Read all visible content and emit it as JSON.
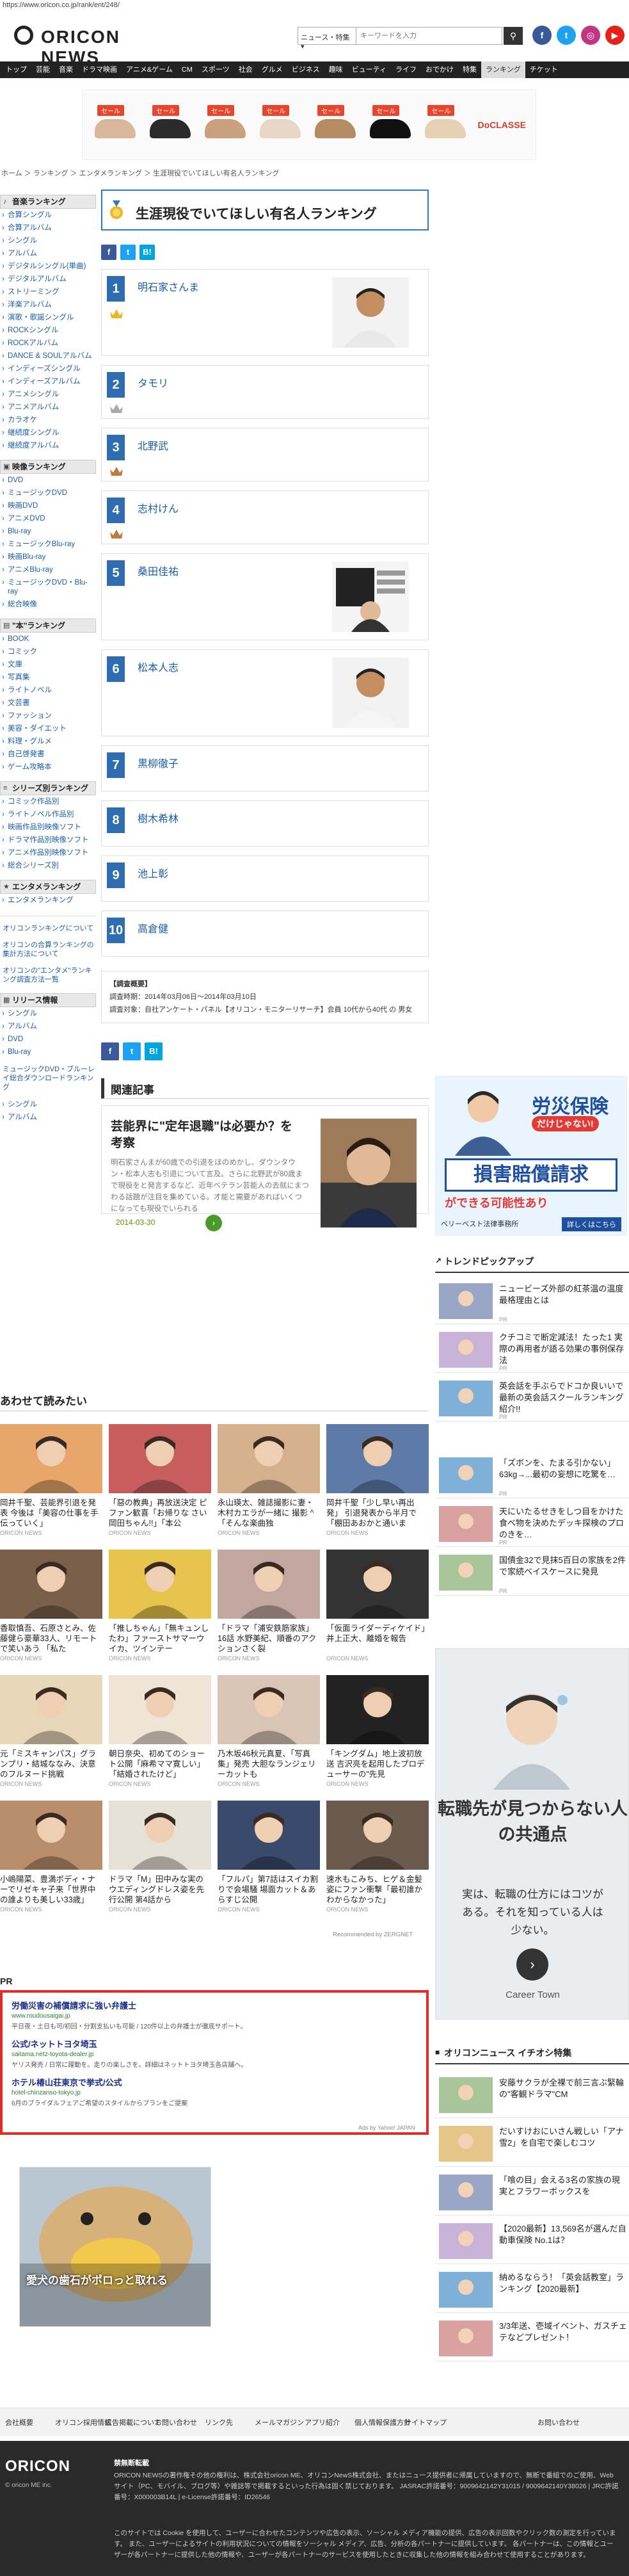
{
  "url": "https://www.oricon.co.jp/rank/ent/248/",
  "header": {
    "logo_text": "ORICON NEWS",
    "search_select": "ニュース・特集",
    "search_placeholder": "キーワードを入力",
    "nav": [
      "トップ",
      "芸能",
      "音楽",
      "ドラマ映画",
      "アニメ&ゲーム",
      "CM",
      "スポーツ",
      "社会",
      "グルメ",
      "ビジネス",
      "趣味",
      "ビューティ",
      "ライフ",
      "おでかけ",
      "特集",
      "ランキング",
      "チケット"
    ]
  },
  "top_ad": {
    "badge": "セール",
    "brand": "DoCLASSE"
  },
  "breadcrumb": "ホーム ＞ ランキング ＞ エンタメランキング ＞ 生涯現役でいてほしい有名人ランキング",
  "sidebar": {
    "music": {
      "heading": "音楽ランキング",
      "items": [
        "合算シングル",
        "合算アルバム",
        "シングル",
        "アルバム",
        "デジタルシングル(単曲)",
        "デジタルアルバム",
        "ストリーミング",
        "洋楽アルバム",
        "演歌・歌謡シングル",
        "ROCKシングル",
        "ROCKアルバム",
        "DANCE & SOULアルバム",
        "インディーズシングル",
        "インディーズアルバム",
        "アニメシングル",
        "アニメアルバム",
        "カラオケ",
        "継続度シングル",
        "継続度アルバム"
      ]
    },
    "video": {
      "heading": "映像ランキング",
      "items": [
        "DVD",
        "ミュージックDVD",
        "映画DVD",
        "アニメDVD",
        "Blu-ray",
        "ミュージックBlu-ray",
        "映画Blu-ray",
        "アニメBlu-ray",
        "ミュージックDVD・Blu-ray",
        "総合映像"
      ]
    },
    "books": {
      "heading": "\"本\"ランキング",
      "items": [
        "BOOK",
        "コミック",
        "文庫",
        "写真集",
        "ライトノベル",
        "文芸書",
        "ファッション",
        "美容・ダイエット",
        "料理・グルメ",
        "自己啓発書",
        "ゲーム攻略本"
      ]
    },
    "series": {
      "heading": "シリーズ別ランキング",
      "items": [
        "コミック作品別",
        "ライトノベル作品別",
        "映画作品別映像ソフト",
        "ドラマ作品別映像ソフト",
        "アニメ作品別映像ソフト",
        "総合シリーズ別"
      ]
    },
    "ent": {
      "heading": "エンタメランキング",
      "items": [
        "エンタメランキング"
      ]
    },
    "links": [
      "オリコンランキングについて",
      "オリコンの合算ランキングの集計方法について",
      "オリコンの\"エンタメ\"ランキング調査方法一覧"
    ],
    "release": {
      "heading": "リリース情報",
      "items": [
        "シングル",
        "アルバム",
        "DVD",
        "Blu-ray"
      ],
      "link": "ミュージックDVD・ブルーレイ総合ダウンロードランキング",
      "items2": [
        "シングル",
        "アルバム"
      ]
    }
  },
  "main": {
    "title": "生涯現役でいてほしい有名人ランキング",
    "ranks": [
      {
        "num": "1",
        "name": "明石家さんま"
      },
      {
        "num": "2",
        "name": "タモリ"
      },
      {
        "num": "3",
        "name": "北野武"
      },
      {
        "num": "4",
        "name": "志村けん"
      },
      {
        "num": "5",
        "name": "桑田佳祐"
      },
      {
        "num": "6",
        "name": "松本人志"
      },
      {
        "num": "7",
        "name": "黒柳徹子"
      },
      {
        "num": "8",
        "name": "樹木希林"
      },
      {
        "num": "9",
        "name": "池上彰"
      },
      {
        "num": "10",
        "name": "高倉健"
      }
    ],
    "survey": {
      "heading": "【調査概要】",
      "period": "調査時期：2014年03月06日～2014年03月10日",
      "target": "調査対象：自社アンケート・パネル【オリコン・モニターリサーチ】会員 10代から40代 の 男女"
    },
    "related": {
      "heading": "関連記事",
      "title": "芸能界に\"定年退職\"は必要か？を考察",
      "body": "明石家さんまが60歳での引退をほのめかし、ダウンタウン・松本人志も引退について言及。さらに北野武が80歳まで現役をと発言するなど、近年ベテラン芸能人の去就にまつわる話題が注目を集めている。才能と需要があればいくつになっても現役でいられる",
      "date": "2014-03-30"
    }
  },
  "also_read": {
    "heading": "あわせて読みたい",
    "items": [
      {
        "caption": "岡井千聖、芸能界引退を発表 今後は「美容の仕事を手伝っていく」",
        "src": "ORICON NEWS"
      },
      {
        "caption": "「惡の教典」再放送決定 ピファン歓喜「お帰りな さい岡田ちゃん!!」「本公",
        "src": "ORICON NEWS"
      },
      {
        "caption": "永山瑛太、雑誌撮影に妻・木村カエラが一緒に 撮影 ^ 「そんな楽曲独",
        "src": "ORICON NEWS"
      },
      {
        "caption": "岡井千聖「少し早い再出発」 引退発表から半月で「棚田あおかと通いま",
        "src": "ORICON NEWS"
      },
      {
        "caption": "香取慎吾、石原さとみ、佐藤健ら豪華33人、リモートで笑いあう 「私た",
        "src": "ORICON NEWS"
      },
      {
        "caption": "「推しちゃん」「無キュンしたわ」ファーストサマーウイカ、ツインテー",
        "src": "ORICON NEWS"
      },
      {
        "caption": "「ドラマ「浦安鉄筋家族」16話 水野美紀、順番のアクションさく裂",
        "src": "ORICON NEWS"
      },
      {
        "caption": "「仮面ライダーディケイド」井上正大、離婚を報告",
        "src": "ORICON NEWS"
      },
      {
        "caption": "元「ミスキャンパス」グランプリ・結城ななみ、決意のフルヌード挑戦",
        "src": "ORICON NEWS"
      },
      {
        "caption": "朝日奈央、初めてのショート公開「麻希ママ寛しい」「結婚されたけど」",
        "src": "ORICON NEWS"
      },
      {
        "caption": "乃木坂46秋元真夏、「写真集」発売 大胆なランジェリーカットも",
        "src": "ORICON NEWS"
      },
      {
        "caption": "「キングダム」地上波初放送 吉沢亮を起用したプロデューサーの\"先見",
        "src": "ORICON NEWS"
      },
      {
        "caption": "小嶋陽菜、豊満ボディ・ナーでリゼキャ子来「世界中の誰よりも美しい33歳」",
        "src": "ORICON NEWS"
      },
      {
        "caption": "ドラマ「M」田中みな実のウエディングドレス姿を先行公開 第4話から",
        "src": "ORICON NEWS"
      },
      {
        "caption": "「フルパ」第7話はスイカ割りで会場騒 場面カット＆あらすじ公開",
        "src": "ORICON NEWS"
      },
      {
        "caption": "速水もこみち、ヒゲ＆金髪姿にファン衝撃「最初誰かわからなかった」",
        "src": "ORICON NEWS"
      }
    ],
    "recommended": "Recommended by ZERGNET"
  },
  "pr": {
    "label": "PR",
    "items": [
      {
        "title": "労働災害の補償請求に強い弁護士",
        "url": "www.roudousaigai.jp",
        "desc": "平日夜・土日も可/初回・分割支払いも可能 / 120件以上の弁護士が徹底サポート。"
      },
      {
        "title": "公式/ネットトヨタ埼玉",
        "url": "saitama.netz-toyota-dealer.jp",
        "desc": "ヤリス発売 / 日常に躍動を。走りの楽しさを。詳細はネットトヨタ埼玉各店舗へ。"
      },
      {
        "title": "ホテル椿山荘東京で挙式/公式",
        "url": "hotel-chinzanso-tokyo.jp",
        "desc": "6月のブライダルフェアご希望のスタイルからプランをご提案"
      }
    ],
    "footer": "Ads by Yahoo! JAPAN"
  },
  "bottom_ad": {
    "caption": "愛犬の歯石がポロっと取れる"
  },
  "right": {
    "ad1": {
      "l1": "労災保険",
      "l2": "だけじゃない!",
      "l3": "損害賠償請求",
      "l4": "ができる可能性あり",
      "l5": "ベリーベスト法律事務所",
      "l6": "詳しくはこちら"
    },
    "trend": {
      "heading": "トレンドピックアップ",
      "items": [
        {
          "text": "ニュービーズ外部の紅茶温の温度最格理由とは",
          "src": "PR"
        },
        {
          "text": "クチコミで断定減法！たった1 実際の再用者が語る効果の事例保存法",
          "src": "PR"
        },
        {
          "text": "英会話を手ぶらでドコか良いいで最新の英会話スクールランキング紹介!!",
          "src": "PR"
        }
      ]
    },
    "trend2": [
      {
        "text": "「ズボンを、たまる引かない」63kg→...最初の妄想に吃驚を…",
        "src": "PR"
      },
      {
        "text": "天にいたるせきをしつ目をかけた食べ物を決めたデッキ探検のプロのきを…",
        "src": "PR"
      },
      {
        "text": "国債金32で見抹5百日の家族を2件で家続ベイスケースに発見",
        "src": "PR"
      }
    ],
    "ad2": {
      "l1": "転職先が見つからない人の共通点",
      "l2": "実は、転職の仕方にはコツがある。それを知っている人は少ない。",
      "l3": "Career Town"
    },
    "featured": {
      "heading": "オリコンニュース イチオシ特集",
      "items": [
        {
          "text": "安藤サクラが全裸で前三言ぶ緊輪の\"客観ドラマ\"CM"
        },
        {
          "text": "だいすけおにいさん戦しい「アナ雪2」を自宅で楽しむコツ"
        },
        {
          "text": "「喰の目」会える3名の家族の現実とフラワーボックスを"
        },
        {
          "text": "【2020最新】13,569名が選んだ自動車保険 No.1は？"
        },
        {
          "text": "納めるならう！「英会話教室」ランキング【2020最新】"
        },
        {
          "text": "3/3年送、壱域イベント、ガスチェテなどプレゼント！"
        }
      ]
    }
  },
  "footer": {
    "nav": [
      "会社概要",
      "オリコン採用情報",
      "広告掲載について",
      "お問い合わせ",
      "リンク先",
      "メールマガジン",
      "アプリ紹介",
      "個人情報保護方針",
      "サイトマップ"
    ],
    "help_label": "お問い合わせ",
    "logo": "ORICON",
    "copyright": "© oricon ME inc.",
    "notice_head": "禁無断転載",
    "notice": "ORICON NEWSの著作権その他の権利は、株式会社oricon ME、オリコンNewS株式会社、またはニュース提供者に帰属していますので、無断で番組でのご使用、Webサイト（PC、モバイル、ブログ等）や雑誌等で掲載するといった行為は固く禁じております。 JASRAC許諾番号：9009642142Y31015 / 9009642140Y38026 | JRC許諾番号：X000003B14L | e-License許諾番号：ID26546",
    "notice2": "このサイトでは Cookie を使用して、ユーザーに合わせたコンテンツや広告の表示、ソーシャル メディア機能の提供、広告の表示回数やクリック数の測定を行っています。 また、ユーザーによるサイトの利用状況についての情報をソーシャル メディア、広告、分析の各パートナーに提供しています。 各パートナーは、この情報とユーザーが各パートナーに提供した他の情報や、ユーザーが各パートナーのサービスを使用したときに収集した他の情報を組み合わせて使用することがあります。"
  }
}
